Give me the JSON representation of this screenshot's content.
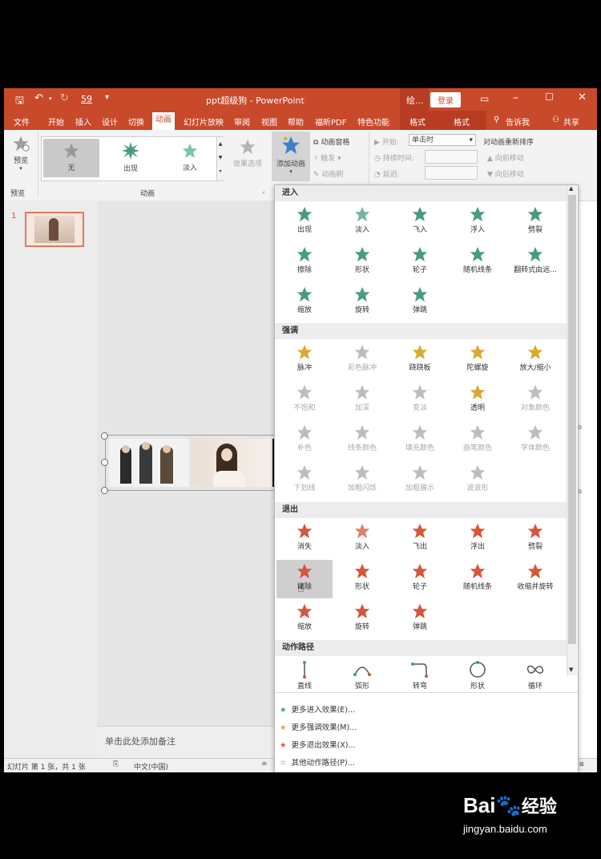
{
  "window": {
    "title": "ppt超级狗 - PowerPoint",
    "tools_label": "绘...",
    "login": "登录",
    "qat_number": "59"
  },
  "tabs": [
    "文件",
    "开始",
    "插入",
    "设计",
    "切换",
    "动画",
    "幻灯片放映",
    "审阅",
    "视图",
    "帮助",
    "福昕PDF",
    "特色功能"
  ],
  "context_tabs": [
    "格式",
    "格式"
  ],
  "tell_me": "告诉我",
  "share": "共享",
  "ribbon": {
    "preview_btn": "预览",
    "preview_group": "预览",
    "anim_group": "动画",
    "gallery": [
      "无",
      "出现",
      "淡入"
    ],
    "effect_options": "效果选项",
    "add_animation": "添加动画",
    "anim_pane": "动画窗格",
    "trigger": "触发",
    "anim_painter": "动画刷",
    "start_label": "开始:",
    "start_value": "单击时",
    "duration_label": "持续时间:",
    "delay_label": "延迟:",
    "reorder_title": "对动画重新排序",
    "move_earlier": "向前移动",
    "move_later": "向后移动"
  },
  "slides": {
    "number": "1"
  },
  "notes_placeholder": "单击此处添加备注",
  "status": {
    "slide_info": "幻灯片 第 1 张，共 1 张",
    "language": "中文(中国)"
  },
  "sections": {
    "entrance": {
      "title": "进入",
      "items": [
        "出现",
        "淡入",
        "飞入",
        "浮入",
        "劈裂",
        "擦除",
        "形状",
        "轮子",
        "随机线条",
        "翻转式由远...",
        "缩放",
        "旋转",
        "弹跳"
      ]
    },
    "emphasis": {
      "title": "强调",
      "items": [
        "脉冲",
        "彩色脉冲",
        "跷跷板",
        "陀螺旋",
        "放大/缩小",
        "不饱和",
        "加深",
        "变淡",
        "透明",
        "对象颜色",
        "补色",
        "线条颜色",
        "填充颜色",
        "画笔颜色",
        "字体颜色",
        "下划线",
        "加粗闪烁",
        "加粗展示",
        "波浪形"
      ]
    },
    "exit": {
      "title": "退出",
      "items": [
        "消失",
        "淡入",
        "飞出",
        "浮出",
        "劈裂",
        "擦除",
        "形状",
        "轮子",
        "随机线条",
        "收缩并旋转",
        "缩放",
        "旋转",
        "弹跳"
      ]
    },
    "paths": {
      "title": "动作路径",
      "items": [
        "直线",
        "弧形",
        "转弯",
        "形状",
        "循环"
      ]
    }
  },
  "more": [
    "更多进入效果(E)...",
    "更多强调效果(M)...",
    "更多退出效果(X)...",
    "其他动作路径(P)..."
  ],
  "watermark": {
    "brand": "Bai",
    "brand2": "经验",
    "url": "jingyan.baidu.com"
  },
  "colors": {
    "accent": "#c9492b",
    "entrance": "#4a9a83",
    "emphasis": "#d8a934",
    "exit": "#d4573b",
    "disabled": "#bdbdbd"
  }
}
